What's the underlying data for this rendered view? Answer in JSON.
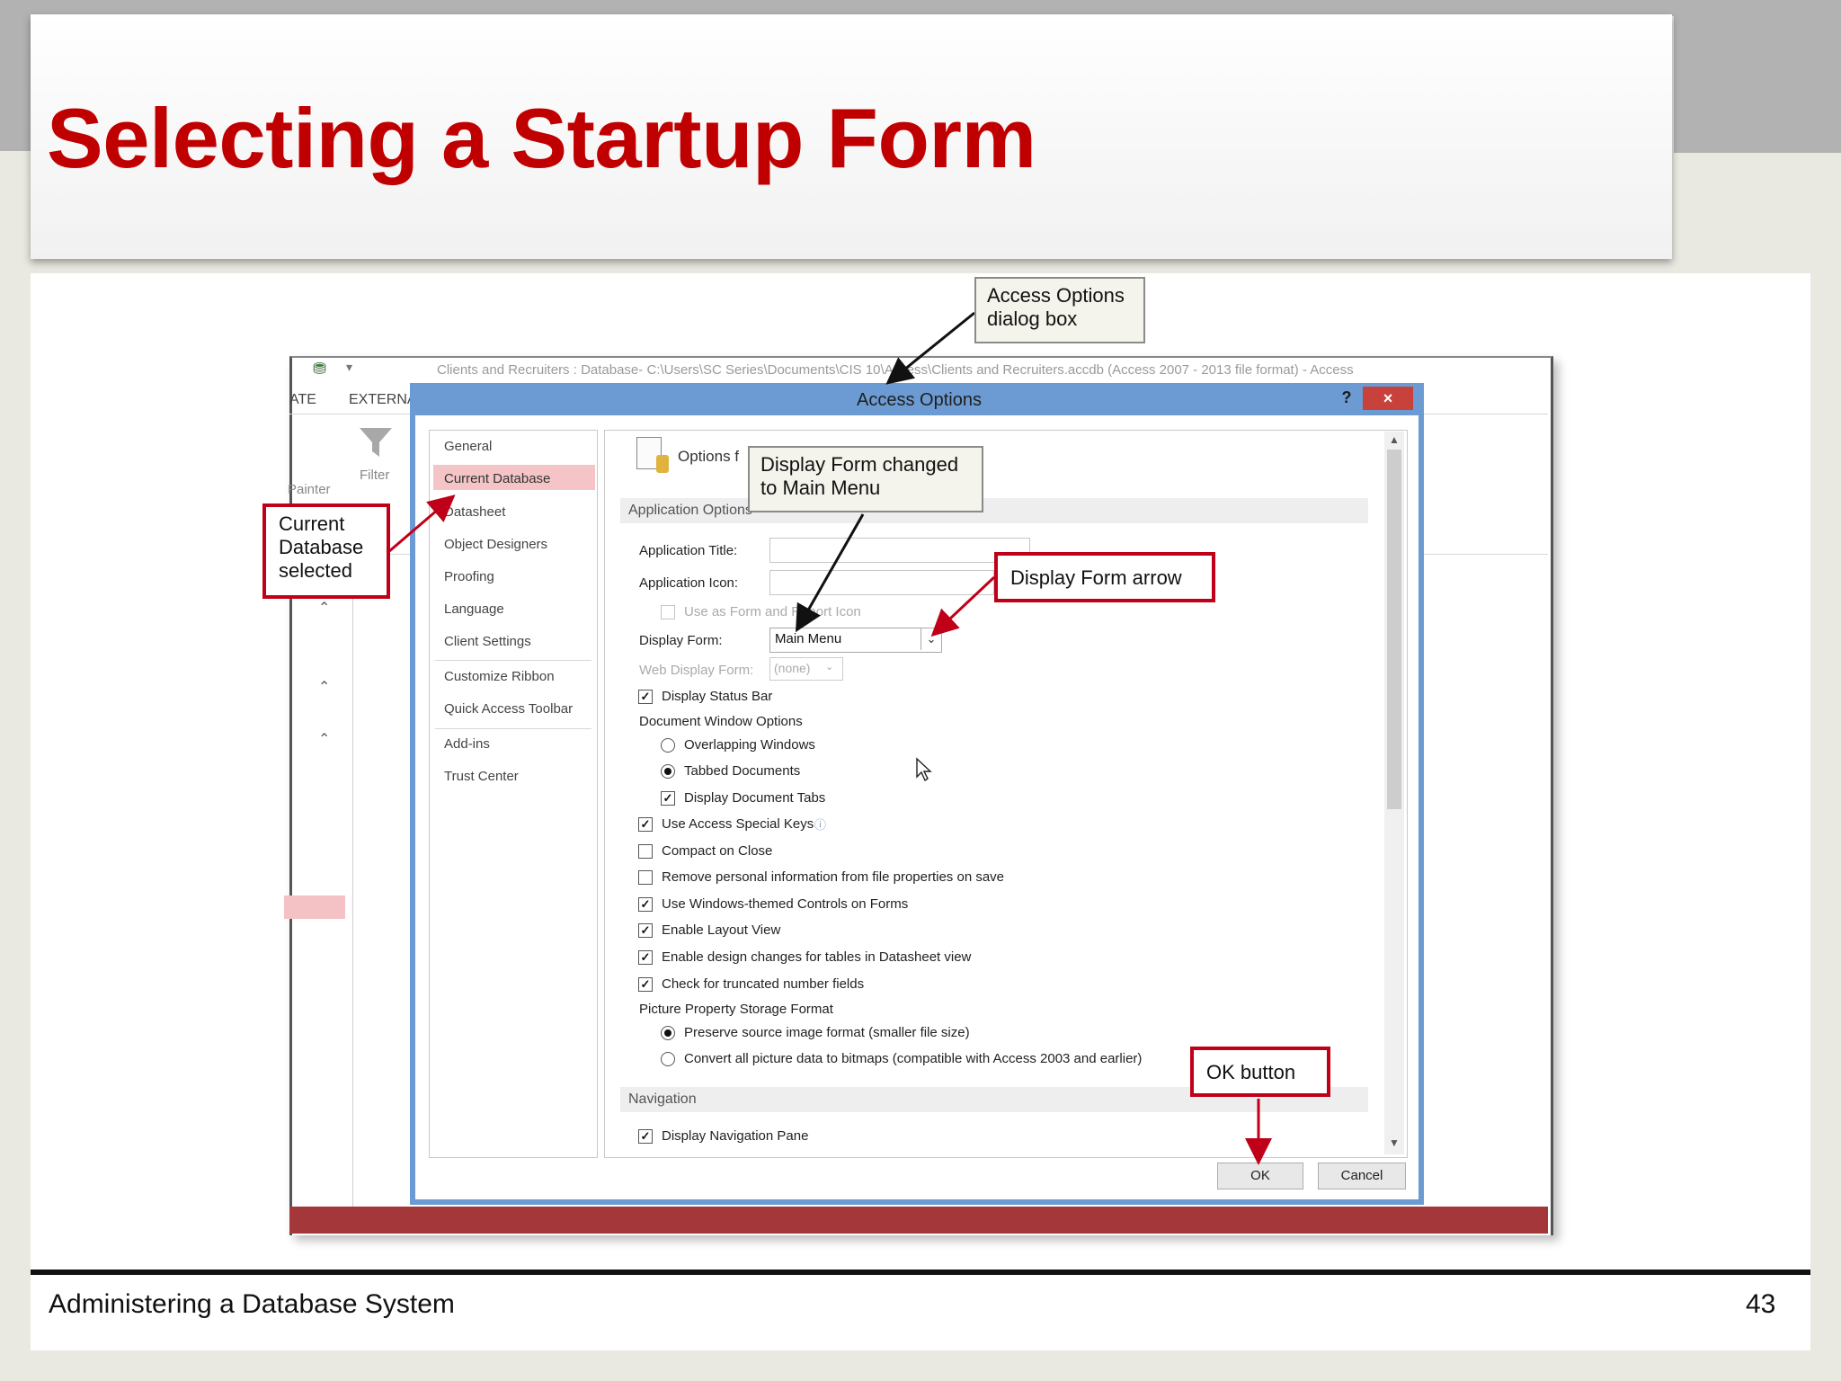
{
  "slide": {
    "title": "Selecting a Startup Form",
    "footer_text": "Administering a Database System",
    "page_number": "43"
  },
  "app_window": {
    "title": "Clients and Recruiters : Database- C:\\Users\\SC Series\\Documents\\CIS 10\\Access\\Clients and Recruiters.accdb (Access 2007 - 2013 file format) - Access",
    "ribbon_tabs": [
      "ATE",
      "EXTERNAL"
    ],
    "filter_label": "Filter",
    "painter_label": "Painter"
  },
  "dialog": {
    "title": "Access Options",
    "help_label": "?",
    "close_label": "×",
    "categories": [
      "General",
      "Current Database",
      "Datasheet",
      "Object Designers",
      "Proofing",
      "Language",
      "Client Settings",
      "Customize Ribbon",
      "Quick Access Toolbar",
      "Add-ins",
      "Trust Center"
    ],
    "selected_category": "Current Database",
    "options_heading": "Options f",
    "sections": {
      "application_options": "Application Options",
      "navigation": "Navigation"
    },
    "fields": {
      "application_title_label": "Application Title:",
      "application_title_value": "",
      "application_icon_label": "Application Icon:",
      "application_icon_value": "",
      "use_as_icon_label": "Use as Form and Report Icon",
      "display_form_label": "Display Form:",
      "display_form_value": "Main Menu",
      "web_display_form_label": "Web Display Form:",
      "web_display_form_value": "(none)"
    },
    "options": [
      {
        "label": "Display Status Bar",
        "checked": true
      },
      {
        "label": "Document Window Options",
        "heading": true
      },
      {
        "label": "Overlapping Windows",
        "radio": true,
        "selected": false
      },
      {
        "label": "Tabbed Documents",
        "radio": true,
        "selected": true
      },
      {
        "label": "Display Document Tabs",
        "checked": true
      },
      {
        "label": "Use Access Special Keys",
        "checked": true
      },
      {
        "label": "Compact on Close",
        "checked": false
      },
      {
        "label": "Remove personal information from file properties on save",
        "checked": false
      },
      {
        "label": "Use Windows-themed Controls on Forms",
        "checked": true
      },
      {
        "label": "Enable Layout View",
        "checked": true
      },
      {
        "label": "Enable design changes for tables in Datasheet view",
        "checked": true
      },
      {
        "label": "Check for truncated number fields",
        "checked": true
      },
      {
        "label": "Picture Property Storage Format",
        "heading": true
      },
      {
        "label": "Preserve source image format (smaller file size)",
        "radio": true,
        "selected": true
      },
      {
        "label": "Convert all picture data to bitmaps (compatible with Access 2003 and earlier)",
        "radio": true,
        "selected": false
      },
      {
        "label": "Display Navigation Pane",
        "checked": true
      }
    ],
    "ok_label": "OK",
    "cancel_label": "Cancel"
  },
  "callouts": {
    "access_options": "Access Options dialog box",
    "current_database": "Current Database selected",
    "display_form_changed": "Display Form changed to Main Menu",
    "display_form_arrow": "Display Form arrow",
    "ok_button": "OK button"
  },
  "colors": {
    "title_red": "#c00000",
    "callout_red": "#c00018",
    "dialog_blue": "#6b9bd2",
    "selected_pink": "#f4c4c6"
  }
}
